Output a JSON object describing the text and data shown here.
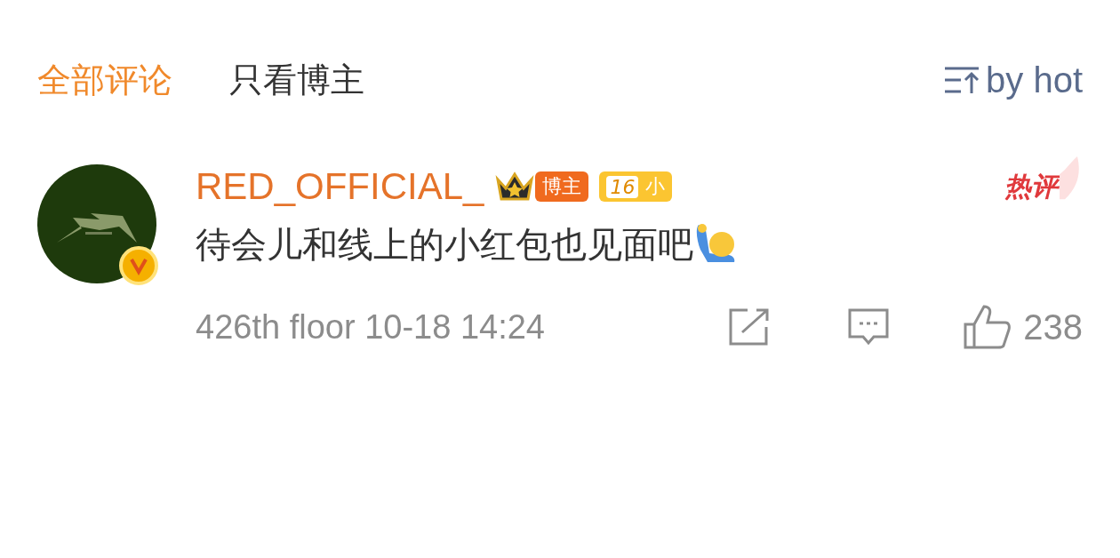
{
  "tabs": [
    {
      "label": "全部评论",
      "selected": true
    },
    {
      "label": "只看博主",
      "selected": false
    }
  ],
  "sort": {
    "label": "by hot"
  },
  "comment": {
    "author": "RED_OFFICIAL_",
    "verified": true,
    "badges": [
      {
        "kind": "crown",
        "label": "博主"
      },
      {
        "kind": "level",
        "number": "16",
        "label": "小"
      }
    ],
    "hot_tag": "热评",
    "text": "待会儿和线上的小红包也见面吧",
    "meta": "426th floor 10-18 14:24",
    "likes": "238"
  }
}
